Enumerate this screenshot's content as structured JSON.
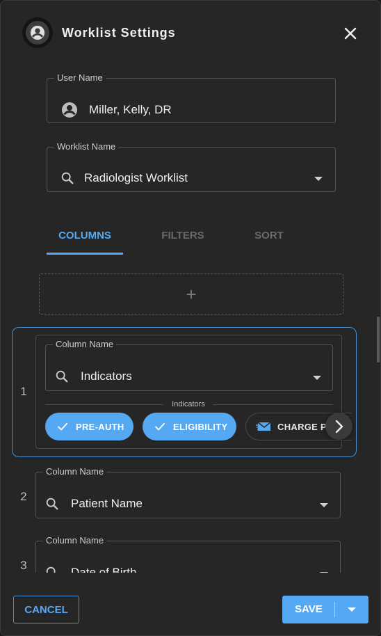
{
  "header": {
    "title": "Worklist Settings"
  },
  "user_field": {
    "legend": "User Name",
    "value": "Miller, Kelly, DR"
  },
  "worklist_field": {
    "legend": "Worklist Name",
    "value": "Radiologist Worklist"
  },
  "tabs": [
    {
      "label": "COLUMNS",
      "active": true
    },
    {
      "label": "FILTERS",
      "active": false
    },
    {
      "label": "SORT",
      "active": false
    }
  ],
  "add_symbol": "+",
  "columns": [
    {
      "number": "1",
      "legend": "Column Name",
      "value": "Indicators",
      "indicators_label": "Indicators",
      "chips": [
        {
          "label": "PRE-AUTH",
          "selected": true,
          "icon": "check-icon"
        },
        {
          "label": "ELIGIBILITY",
          "selected": true,
          "icon": "check-icon"
        },
        {
          "label": "CHARGE POSTED",
          "selected": false,
          "icon": "charge-envelope-icon"
        }
      ]
    },
    {
      "number": "2",
      "legend": "Column Name",
      "value": "Patient Name"
    },
    {
      "number": "3",
      "legend": "Column Name",
      "value": "Date of Birth"
    }
  ],
  "footer": {
    "cancel_label": "CANCEL",
    "save_label": "SAVE"
  },
  "colors": {
    "accent": "#55a9f2",
    "panel": "#262626",
    "border": "#555555"
  }
}
